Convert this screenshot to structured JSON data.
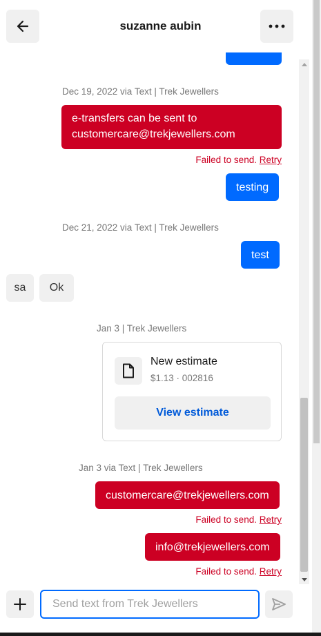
{
  "header": {
    "title": "suzanne aubin",
    "back_icon": "arrow-left-icon",
    "more_icon": "ellipsis-icon"
  },
  "messages": {
    "stamp_1": "Dec 19, 2022 via Text | Trek Jewellers",
    "bubble_etransfer_line1": "e-transfers can be sent to",
    "bubble_etransfer_line2": "customercare@trekjewellers.com",
    "fail_1": "Failed to send.",
    "retry_1": "Retry",
    "bubble_testing": "testing",
    "stamp_2": "Dec 21, 2022 via Text | Trek Jewellers",
    "bubble_test": "test",
    "avatar_initials": "sa",
    "incoming_ok": "Ok",
    "stamp_3": "Jan 3 | Trek Jewellers",
    "stamp_4": "Jan 3 via Text | Trek Jewellers",
    "bubble_customercare": "customercare@trekjewellers.com",
    "fail_2": "Failed to send.",
    "retry_2": "Retry",
    "bubble_info": "info@trekjewellers.com",
    "fail_3": "Failed to send.",
    "retry_3": "Retry"
  },
  "estimate_card": {
    "title": "New estimate",
    "subtitle": "$1.13 · 002816",
    "button_label": "View estimate",
    "icon": "document-icon"
  },
  "composer": {
    "placeholder": "Send text from Trek Jewellers",
    "value": "",
    "plus_icon": "plus-icon",
    "send_icon": "send-icon"
  },
  "colors": {
    "blue_bubble": "#006aff",
    "red_bubble": "#cc0023",
    "link_blue": "#005ad9",
    "grey_surface": "#f0f0f0"
  }
}
